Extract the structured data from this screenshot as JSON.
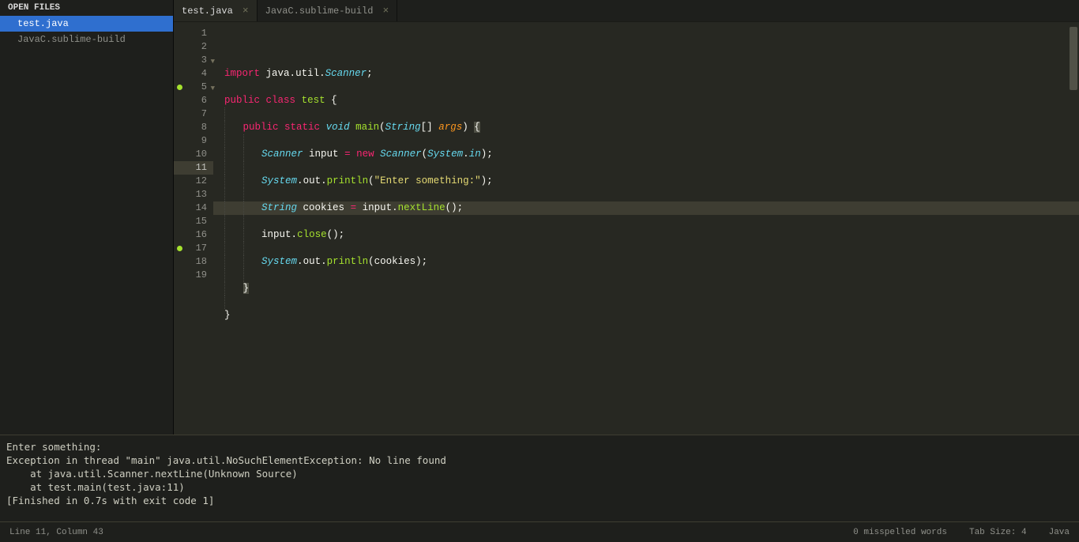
{
  "sidebar": {
    "header": "OPEN FILES",
    "files": [
      {
        "name": "test.java",
        "active": true
      },
      {
        "name": "JavaC.sublime-build",
        "active": false
      }
    ]
  },
  "tabs": [
    {
      "label": "test.java",
      "active": true
    },
    {
      "label": "JavaC.sublime-build",
      "active": false
    }
  ],
  "code": {
    "lines": [
      {
        "n": 1,
        "tokens": [
          [
            "kw",
            "import"
          ],
          [
            "plain",
            " "
          ],
          [
            "plain",
            "java"
          ],
          [
            "punc",
            "."
          ],
          [
            "plain",
            "util"
          ],
          [
            "punc",
            "."
          ],
          [
            "type",
            "Scanner"
          ],
          [
            "punc",
            ";"
          ]
        ]
      },
      {
        "n": 2,
        "tokens": []
      },
      {
        "n": 3,
        "fold": true,
        "tokens": [
          [
            "kw",
            "public"
          ],
          [
            "plain",
            " "
          ],
          [
            "kw",
            "class"
          ],
          [
            "plain",
            " "
          ],
          [
            "cls",
            "test"
          ],
          [
            "plain",
            " "
          ],
          [
            "punc",
            "{"
          ]
        ]
      },
      {
        "n": 4,
        "indent": 1,
        "tokens": []
      },
      {
        "n": 5,
        "fold": true,
        "marker": true,
        "indent": 1,
        "tokens": [
          [
            "kw",
            "public"
          ],
          [
            "plain",
            " "
          ],
          [
            "kw",
            "static"
          ],
          [
            "plain",
            " "
          ],
          [
            "type",
            "void"
          ],
          [
            "plain",
            " "
          ],
          [
            "fn",
            "main"
          ],
          [
            "punc",
            "("
          ],
          [
            "type",
            "String"
          ],
          [
            "punc",
            "[]"
          ],
          [
            "plain",
            " "
          ],
          [
            "var",
            "args"
          ],
          [
            "punc",
            ") "
          ],
          [
            "bracket",
            "{"
          ]
        ]
      },
      {
        "n": 6,
        "indent": 2,
        "tokens": []
      },
      {
        "n": 7,
        "indent": 2,
        "tokens": [
          [
            "type",
            "Scanner"
          ],
          [
            "plain",
            " input "
          ],
          [
            "op",
            "="
          ],
          [
            "plain",
            " "
          ],
          [
            "op",
            "new"
          ],
          [
            "plain",
            " "
          ],
          [
            "type",
            "Scanner"
          ],
          [
            "punc",
            "("
          ],
          [
            "type",
            "System"
          ],
          [
            "punc",
            "."
          ],
          [
            "const",
            "in"
          ],
          [
            "punc",
            ");"
          ]
        ]
      },
      {
        "n": 8,
        "indent": 2,
        "tokens": []
      },
      {
        "n": 9,
        "indent": 2,
        "tokens": [
          [
            "type",
            "System"
          ],
          [
            "punc",
            "."
          ],
          [
            "plain",
            "out"
          ],
          [
            "punc",
            "."
          ],
          [
            "fn",
            "println"
          ],
          [
            "punc",
            "("
          ],
          [
            "str",
            "\"Enter something:\""
          ],
          [
            "punc",
            ");"
          ]
        ]
      },
      {
        "n": 10,
        "indent": 2,
        "tokens": []
      },
      {
        "n": 11,
        "indent": 2,
        "current": true,
        "tokens": [
          [
            "type",
            "String"
          ],
          [
            "plain",
            " cookies "
          ],
          [
            "op",
            "="
          ],
          [
            "plain",
            " input"
          ],
          [
            "punc",
            "."
          ],
          [
            "fn",
            "nextLine"
          ],
          [
            "punc",
            "();"
          ]
        ]
      },
      {
        "n": 12,
        "indent": 2,
        "tokens": []
      },
      {
        "n": 13,
        "indent": 2,
        "tokens": [
          [
            "plain",
            "input"
          ],
          [
            "punc",
            "."
          ],
          [
            "fn",
            "close"
          ],
          [
            "punc",
            "();"
          ]
        ]
      },
      {
        "n": 14,
        "indent": 2,
        "tokens": []
      },
      {
        "n": 15,
        "indent": 2,
        "tokens": [
          [
            "type",
            "System"
          ],
          [
            "punc",
            "."
          ],
          [
            "plain",
            "out"
          ],
          [
            "punc",
            "."
          ],
          [
            "fn",
            "println"
          ],
          [
            "punc",
            "(cookies);"
          ]
        ]
      },
      {
        "n": 16,
        "indent": 2,
        "tokens": []
      },
      {
        "n": 17,
        "indent": 1,
        "marker": true,
        "tokens": [
          [
            "bracket",
            "}"
          ]
        ]
      },
      {
        "n": 18,
        "indent": 1,
        "tokens": []
      },
      {
        "n": 19,
        "indent": 0,
        "tokens": [
          [
            "punc",
            "}"
          ]
        ]
      }
    ]
  },
  "console_lines": [
    "Enter something:",
    "Exception in thread \"main\" java.util.NoSuchElementException: No line found",
    "    at java.util.Scanner.nextLine(Unknown Source)",
    "    at test.main(test.java:11)",
    "[Finished in 0.7s with exit code 1]"
  ],
  "status": {
    "position": "Line 11, Column 43",
    "spell": "0 misspelled words",
    "tabsize": "Tab Size: 4",
    "syntax": "Java"
  }
}
